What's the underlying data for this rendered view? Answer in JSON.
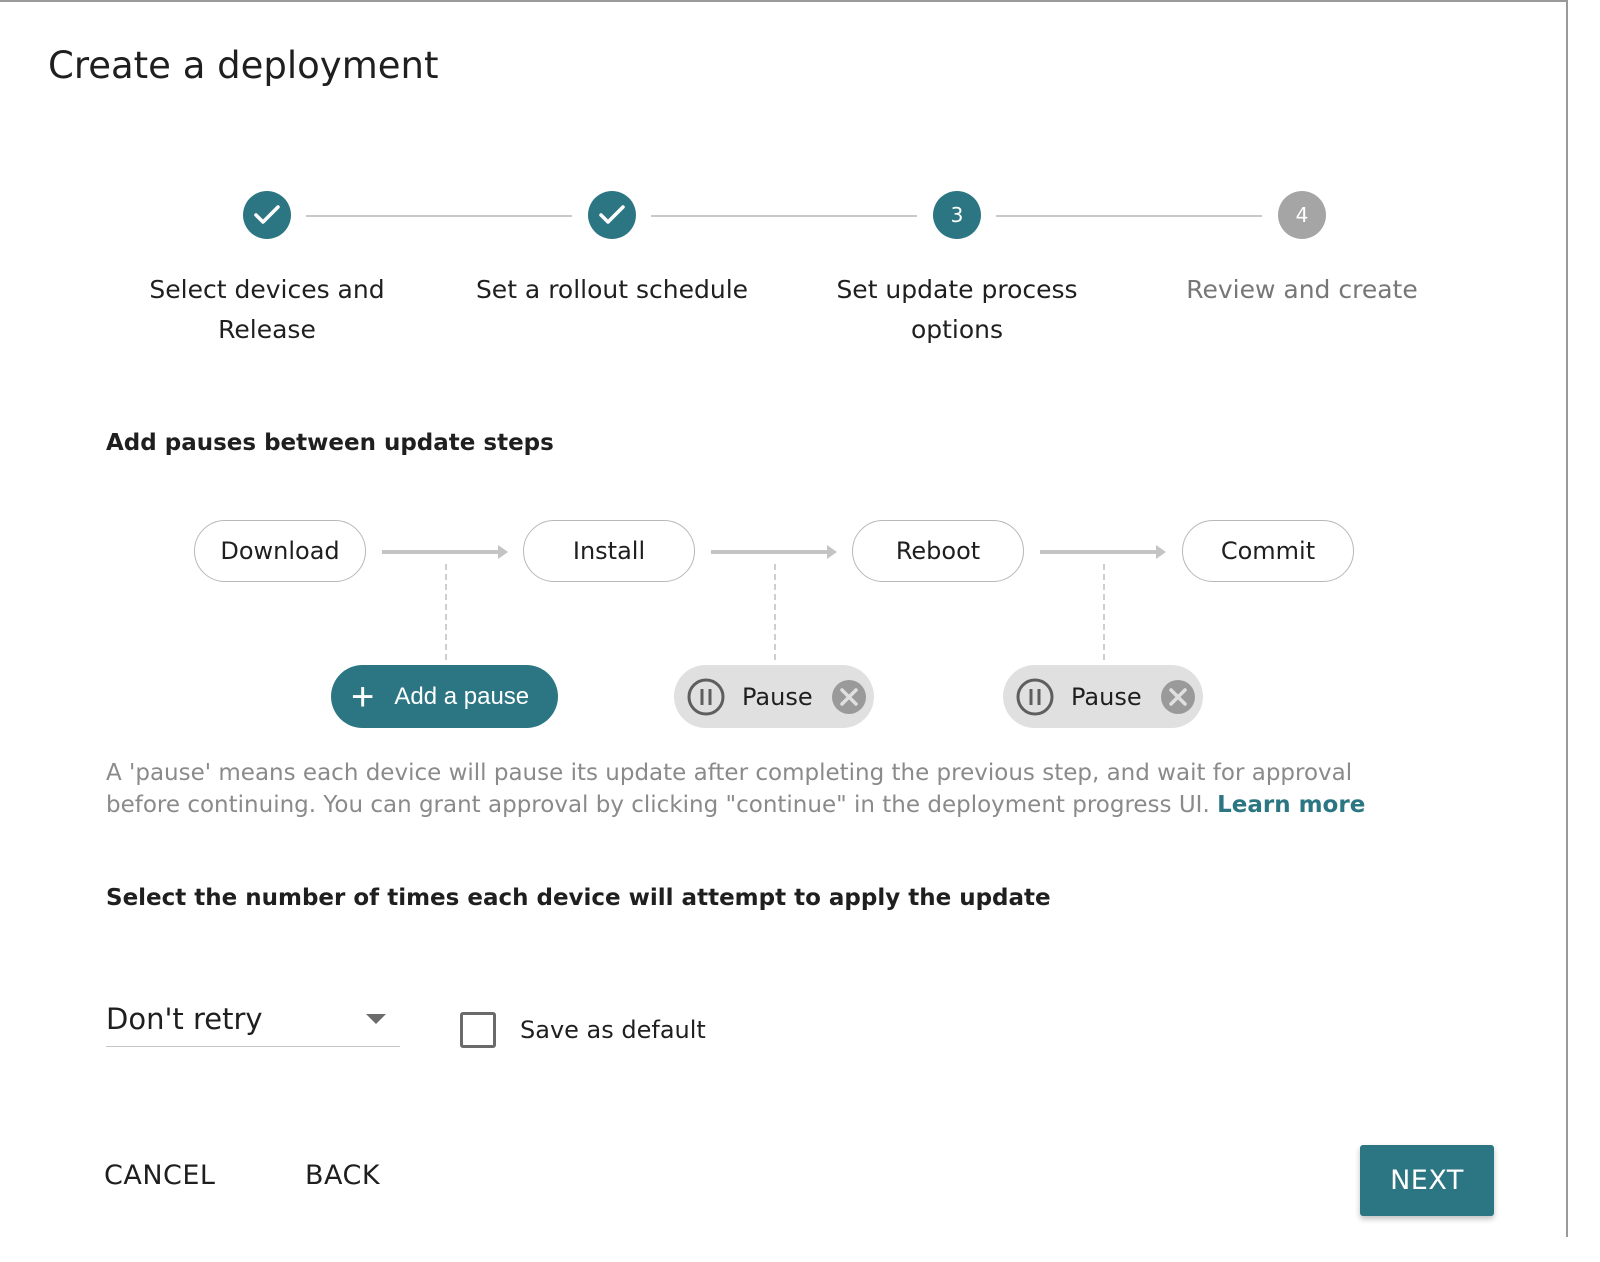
{
  "dialog": {
    "title": "Create a deployment"
  },
  "stepper": {
    "steps": [
      {
        "label": "Select devices and Release",
        "state": "done",
        "number": "1"
      },
      {
        "label": "Set a rollout schedule",
        "state": "done",
        "number": "2"
      },
      {
        "label": "Set update process options",
        "state": "active",
        "number": "3"
      },
      {
        "label": "Review and create",
        "state": "pending",
        "number": "4"
      }
    ]
  },
  "pauses": {
    "heading": "Add pauses between update steps",
    "flow_steps": [
      "Download",
      "Install",
      "Reboot",
      "Commit"
    ],
    "add_pause_label": "Add a pause",
    "pause_chips": [
      {
        "label": "Pause"
      },
      {
        "label": "Pause"
      }
    ],
    "help_text": "A 'pause' means each device will pause its update after completing the previous step, and wait for approval before continuing. You can grant approval by clicking \"continue\" in the deployment progress UI. ",
    "learn_more": "Learn more"
  },
  "retries": {
    "heading": "Select the number of times each device will attempt to apply the update",
    "selected": "Don't retry",
    "save_default_label": "Save as default",
    "save_default_checked": false
  },
  "footer": {
    "cancel": "CANCEL",
    "back": "BACK",
    "next": "NEXT"
  },
  "colors": {
    "accent": "#2c7683",
    "pending": "#a5a5a5",
    "chip_bg": "#e0e0e0"
  }
}
